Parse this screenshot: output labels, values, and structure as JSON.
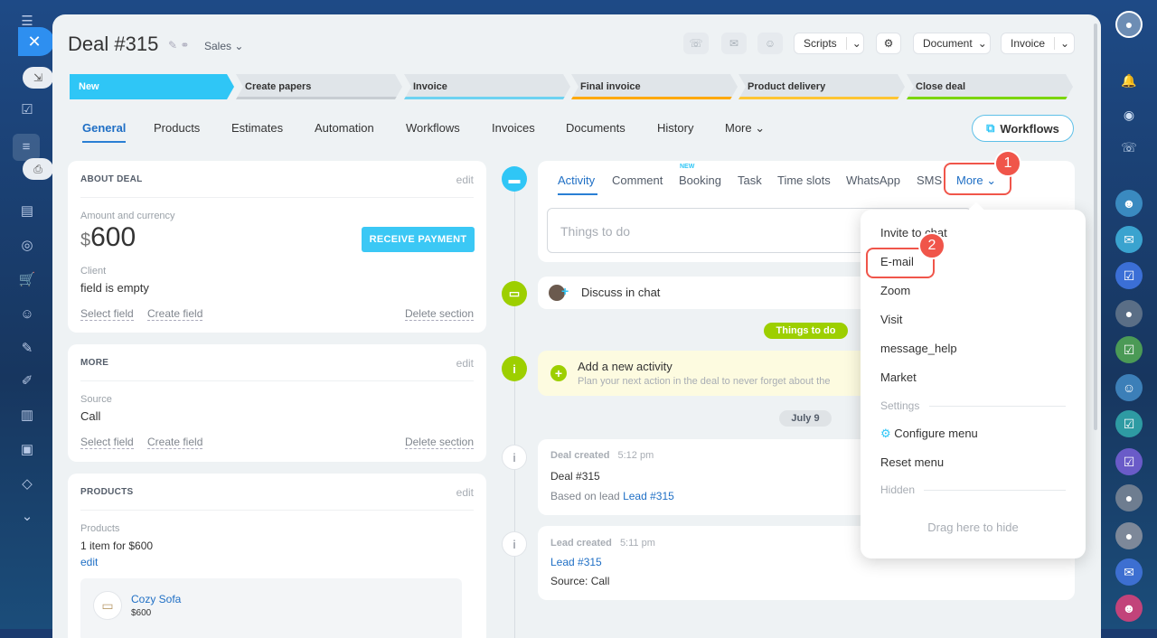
{
  "deal": {
    "title": "Deal #315",
    "pipeline": "Sales"
  },
  "toolbar": {
    "scripts": "Scripts",
    "document": "Document",
    "invoice": "Invoice"
  },
  "stages": [
    {
      "label": "New",
      "color": "#2fc6f6"
    },
    {
      "label": "Create papers",
      "color": "#d9dee3"
    },
    {
      "label": "Invoice",
      "color": "#6dd2f1"
    },
    {
      "label": "Final invoice",
      "color": "#ffa900"
    },
    {
      "label": "Product delivery",
      "color": "#ffc533"
    },
    {
      "label": "Close deal",
      "color": "#7bd500"
    }
  ],
  "tabs": [
    "General",
    "Products",
    "Estimates",
    "Automation",
    "Workflows",
    "Invoices",
    "Documents",
    "History",
    "More"
  ],
  "workflows_button": "Workflows",
  "about": {
    "heading": "ABOUT DEAL",
    "edit": "edit",
    "amount_label": "Amount and currency",
    "currency": "$",
    "amount": "600",
    "receive_payment": "RECEIVE PAYMENT",
    "client_label": "Client",
    "client_value": "field is empty",
    "select_field": "Select field",
    "create_field": "Create field",
    "delete_section": "Delete section"
  },
  "more_section": {
    "heading": "MORE",
    "edit": "edit",
    "source_label": "Source",
    "source_value": "Call",
    "select_field": "Select field",
    "create_field": "Create field",
    "delete_section": "Delete section"
  },
  "products": {
    "heading": "PRODUCTS",
    "edit": "edit",
    "label": "Products",
    "summary": "1 item for $600",
    "edit_link": "edit",
    "item_name": "Cozy Sofa",
    "item_price": "$600"
  },
  "activity": {
    "tabs": [
      "Activity",
      "Comment",
      "Booking",
      "Task",
      "Time slots",
      "WhatsApp",
      "SMS",
      "More"
    ],
    "new_badge": "NEW",
    "placeholder": "Things to do"
  },
  "feed": {
    "discuss": "Discuss in chat",
    "things_pill": "Things to do",
    "add_title": "Add a new activity",
    "add_sub": "Plan your next action in the deal to never forget about the",
    "date_pill": "July 9",
    "deal_created": {
      "title": "Deal created",
      "time": "5:12 pm",
      "line1": "Deal #315",
      "based_on": "Based on lead",
      "lead_link": "Lead #315"
    },
    "lead_created": {
      "title": "Lead created",
      "time": "5:11 pm",
      "link": "Lead #315",
      "source": "Source: Call"
    }
  },
  "menu": {
    "items": [
      "Invite to chat",
      "E-mail",
      "Zoom",
      "Visit",
      "message_help",
      "Market"
    ],
    "settings_label": "Settings",
    "configure": "Configure menu",
    "reset": "Reset menu",
    "hidden_label": "Hidden",
    "drag_hint": "Drag here to hide"
  },
  "callouts": {
    "one": "1",
    "two": "2"
  }
}
